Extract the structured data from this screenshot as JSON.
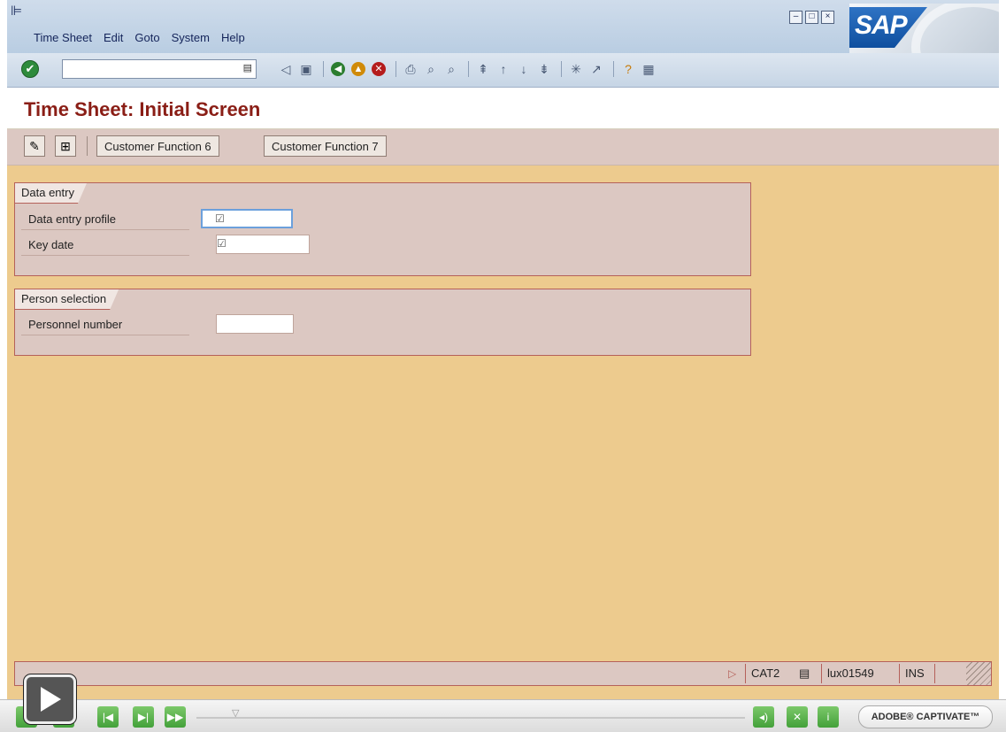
{
  "menu": {
    "items": [
      "Time Sheet",
      "Edit",
      "Goto",
      "System",
      "Help"
    ]
  },
  "logo": "SAP",
  "toolbar": {
    "command_field_value": ""
  },
  "screen": {
    "title": "Time Sheet: Initial Screen"
  },
  "app_toolbar": {
    "customer_function_6": "Customer Function 6",
    "customer_function_7": "Customer Function 7"
  },
  "data_entry": {
    "group_title": "Data entry",
    "profile_label": "Data entry profile",
    "profile_value": "",
    "key_date_label": "Key date",
    "key_date_value": ""
  },
  "person_selection": {
    "group_title": "Person selection",
    "personnel_number_label": "Personnel number",
    "personnel_number_value": ""
  },
  "status_bar": {
    "transaction": "CAT2",
    "server": "lux01549",
    "mode": "INS"
  },
  "player": {
    "brand": "ADOBE® CAPTIVATE™"
  }
}
